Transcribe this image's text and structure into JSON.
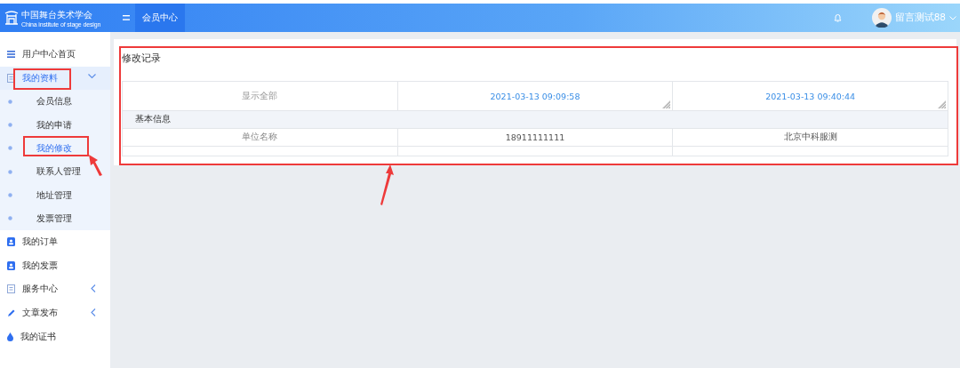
{
  "header": {
    "logo": {
      "title": "中国舞台美术学会",
      "subtitle": "China institute of stage design"
    },
    "nav_tabs": [
      {
        "label": "会员中心",
        "selected": true
      }
    ],
    "user": {
      "name": "留言测试88"
    }
  },
  "sidebar": {
    "items": [
      {
        "kind": "menu",
        "label": "用户中心首页",
        "selected": false
      },
      {
        "kind": "group",
        "label": "我的资料",
        "selected": true,
        "expanded": true,
        "children": [
          {
            "label": "会员信息",
            "selected": false
          },
          {
            "label": "我的申请",
            "selected": false
          },
          {
            "label": "我的修改",
            "selected": true
          },
          {
            "label": "联系人管理",
            "selected": false
          },
          {
            "label": "地址管理",
            "selected": false
          },
          {
            "label": "发票管理",
            "selected": false
          }
        ]
      },
      {
        "kind": "menu",
        "label": "我的订单",
        "selected": false
      },
      {
        "kind": "menu",
        "label": "我的发票",
        "selected": false
      },
      {
        "kind": "group",
        "label": "服务中心",
        "selected": false,
        "expanded": false
      },
      {
        "kind": "group",
        "label": "文章发布",
        "selected": false,
        "expanded": false
      },
      {
        "kind": "menu",
        "label": "我的证书",
        "selected": false
      }
    ]
  },
  "card": {
    "title": "修改记录",
    "table": {
      "columns": [
        "显示全部",
        "2021-03-13 09:09:58",
        "2021-03-13 09:40:44"
      ],
      "rows": [
        {
          "kind": "section",
          "cells": [
            {
              "text": "基本信息",
              "colspan": 3
            }
          ]
        },
        {
          "kind": "data",
          "cells": [
            "单位名称",
            "18911111111",
            "北京中科服测"
          ]
        },
        {
          "kind": "data",
          "cells": [
            "",
            "",
            ""
          ]
        }
      ]
    }
  }
}
